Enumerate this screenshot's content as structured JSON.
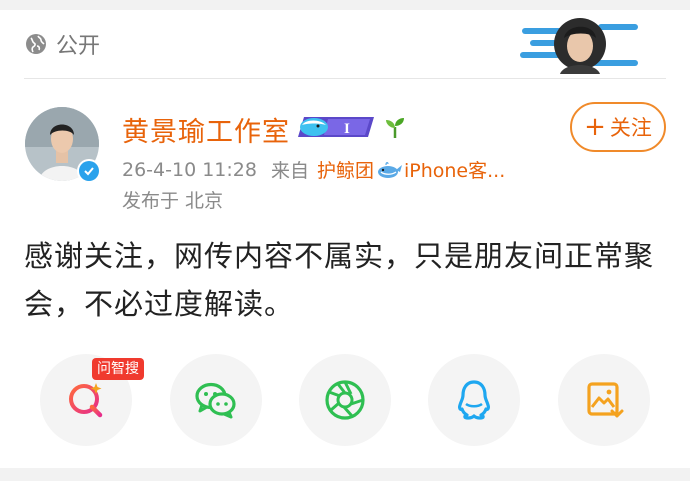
{
  "visibility": {
    "label": "公开",
    "icon": "globe-icon"
  },
  "author": {
    "name": "黄景瑜工作室",
    "badges": [
      "member-badge",
      "sprout-icon"
    ],
    "verified": true,
    "follow_label": "关注"
  },
  "meta": {
    "time": "26-4-10 11:28",
    "from_prefix": "来自",
    "source_name": "护鲸团",
    "source_device": "iPhone客...",
    "location": "发布于 北京"
  },
  "post": {
    "text": "感谢关注，网传内容不属实，只是朋友间正常聚会，不必过度解读。"
  },
  "share": {
    "items": [
      {
        "icon": "search-ai-icon",
        "tag": "问智搜"
      },
      {
        "icon": "wechat-icon"
      },
      {
        "icon": "moments-icon"
      },
      {
        "icon": "qq-icon"
      },
      {
        "icon": "save-image-icon"
      }
    ]
  },
  "colors": {
    "accent": "#e8630a",
    "verified": "#2aa2ec",
    "tag_red": "#f03a2e"
  }
}
